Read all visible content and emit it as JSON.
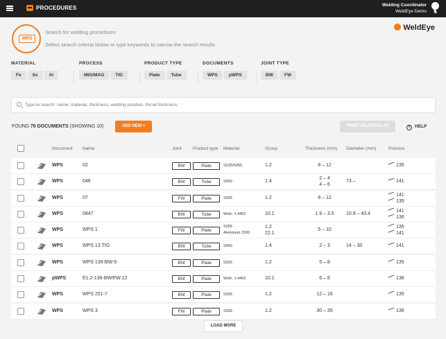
{
  "topbar": {
    "title": "PROCEDURES",
    "user_name": "Welding Coordinator",
    "org": "WeldEye Demo"
  },
  "search": {
    "logo_tag": "WPS",
    "title": "Search for welding procedures",
    "subtitle": "Select search criteria below or type keywords to narrow the search results",
    "placeholder": "Type to search: name, material, thickness, welding position, throat thickness,"
  },
  "brand": "WeldEye",
  "filters": [
    {
      "label": "MATERIAL",
      "chips": [
        "Fe",
        "Ss",
        "Al"
      ]
    },
    {
      "label": "PROCESS",
      "chips": [
        "MIG/MAG",
        "TIG"
      ]
    },
    {
      "label": "PRODUCT TYPE",
      "chips": [
        "Plate",
        "Tube"
      ]
    },
    {
      "label": "DOCUMENTS",
      "chips": [
        "WPS",
        "pWPS"
      ]
    },
    {
      "label": "JOINT TYPE",
      "chips": [
        "BW",
        "FW"
      ]
    }
  ],
  "results": {
    "found_prefix": "FOUND ",
    "found_count": "76 DOCUMENTS",
    "found_suffix": " (SHOWING 10)",
    "add_new": "ADD NEW +",
    "print_selected": "PRINT SELECTED (0)",
    "help": "HELP"
  },
  "columns": {
    "document": "Document",
    "name": "Name",
    "joint": "Joint",
    "product_type": "Product type",
    "material": "Material",
    "group": "Group",
    "thickness": "Thickness (mm)",
    "diameter": "Diameter (mm)",
    "process": "Process"
  },
  "rows": [
    {
      "doc": "WPS",
      "name": "02",
      "joint": "BW",
      "product": "Plate",
      "material": "S235/S355",
      "group": "1.2",
      "thickness": "8 – 12",
      "diameter": "",
      "process": [
        "135"
      ]
    },
    {
      "doc": "WPS",
      "name": "046",
      "joint": "BW",
      "product": "Tube",
      "material": "S450",
      "group": "1.4",
      "thickness": [
        "2 – 4",
        "4 – 6"
      ],
      "diameter": "73 –",
      "process": [
        "141"
      ]
    },
    {
      "doc": "WPS",
      "name": "07",
      "joint": "FW",
      "product": "Plate",
      "material": "S355",
      "group": "1.2",
      "thickness": "8 – 12",
      "diameter": "",
      "process": [
        "141",
        "135"
      ]
    },
    {
      "doc": "WPS",
      "name": "0847",
      "joint": "BW",
      "product": "Tube",
      "material": "Wstn. 1.4462",
      "group": "10.1",
      "thickness": "1.9 – 3.5",
      "diameter": "10.9 – 43.4",
      "process": [
        "141",
        "136"
      ]
    },
    {
      "doc": "WPS",
      "name": "WPS 1",
      "joint": "FW",
      "product": "Plate",
      "material": [
        "S355",
        "Aluminum 2300"
      ],
      "group": [
        "1.2",
        "22.1"
      ],
      "thickness": "5 – 10",
      "diameter": "",
      "process": [
        "135",
        "141"
      ]
    },
    {
      "doc": "WPS",
      "name": "WPS 13 TIG",
      "joint": "BW",
      "product": "Tube",
      "material": "S450",
      "group": "1.4",
      "thickness": "2 – 3",
      "diameter": "14 – 30",
      "process": [
        "141"
      ]
    },
    {
      "doc": "WPS",
      "name": "WPS 135-BW-5",
      "joint": "BW",
      "product": "Plate",
      "material": "S355",
      "group": "1.2",
      "thickness": "5 – 8",
      "diameter": "",
      "process": [
        "135"
      ]
    },
    {
      "doc": "pWPS",
      "name": "E1.2-136-BW/FW 22",
      "joint": "BW",
      "product": "Plate",
      "material": "Wstn. 1.4462",
      "group": "10.1",
      "thickness": "6 – 8",
      "diameter": "",
      "process": [
        "136"
      ]
    },
    {
      "doc": "WPS",
      "name": "WPS 251-7",
      "joint": "BW",
      "product": "Plate",
      "material": "S355",
      "group": "1.2",
      "thickness": "12 – 16",
      "diameter": "",
      "process": [
        "135"
      ]
    },
    {
      "doc": "WPS",
      "name": "WPS 3",
      "joint": "FW",
      "product": "Plate",
      "material": "S355",
      "group": "1.2",
      "thickness": "30 – 35",
      "diameter": "",
      "process": [
        "136"
      ]
    }
  ],
  "load_more": "LOAD MORE",
  "colors": {
    "accent": "#f07d21",
    "topbar": "#1f1f1f"
  }
}
